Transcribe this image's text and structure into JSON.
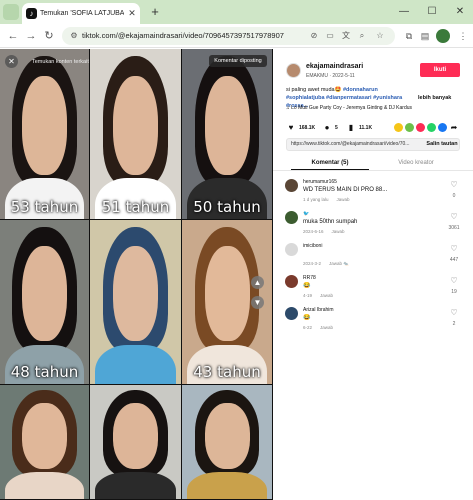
{
  "browser": {
    "tab_title": "Temukan 'SOFIA LATJUBA'",
    "tab_close": "✕",
    "new_tab": "+",
    "window_controls": {
      "minimize": "—",
      "maximize": "☐",
      "close": "✕"
    },
    "url": "tiktok.com/@ekajamaindrasari/video/7096457397517978907?...",
    "accent": "#cfe6c7"
  },
  "video": {
    "search_similar": "Temukan konten terkait",
    "report_button": "Komentar diposting",
    "ages": [
      "53 tahun",
      "51 tahun",
      "50 tahun",
      "48 tahun",
      "",
      "43 tahun",
      "",
      "",
      ""
    ]
  },
  "post": {
    "username": "ekajamaindrasari",
    "subline": "EMAKMU · 2022-5-11",
    "follow": "Ikuti",
    "caption_prefix": "si paling awet muda🤩 ",
    "hashtags": "#donnaharun #sophialatjuba #dianpermatasari #yunishara #rossa...",
    "more": "lebih banyak",
    "music": "♫ Lo Muti Gue Party Coy - Jeremya Ginting & DJ Kardus",
    "likes": "168.1K",
    "comments": "5",
    "bookmarks": "11.1K",
    "link": "https://www.tiktok.com/@ekajamaindrasari/video/70...",
    "copy_link": "Salin tautan",
    "tab_comments": "Komentar (5)",
    "tab_creator": "Video kreator"
  },
  "comments": [
    {
      "user": "herumamur165",
      "text": "WD TERUS MAIN DI PRO 88...",
      "date": "1 d yang lalu",
      "reply": "Jawab",
      "likes": "0",
      "color": "#5a4636"
    },
    {
      "user": "🐦",
      "text": "muka 50thn sumpah",
      "date": "2024-6-16",
      "reply": "Jawab",
      "likes": "3061",
      "color": "#3c5c30"
    },
    {
      "user": "imiciboni",
      "text": "",
      "date": "2024-3-2",
      "reply": "Jawab 🐀",
      "likes": "447",
      "color": "#d9d9d9"
    },
    {
      "user": "RR78",
      "text": "😂",
      "date": "4-19",
      "reply": "Jawab",
      "likes": "19",
      "color": "#7a3a2c"
    },
    {
      "user": "Arizal Ibrahim",
      "text": "😂",
      "date": "6-22",
      "reply": "Jawab",
      "likes": "2",
      "color": "#2c4a6a"
    }
  ]
}
